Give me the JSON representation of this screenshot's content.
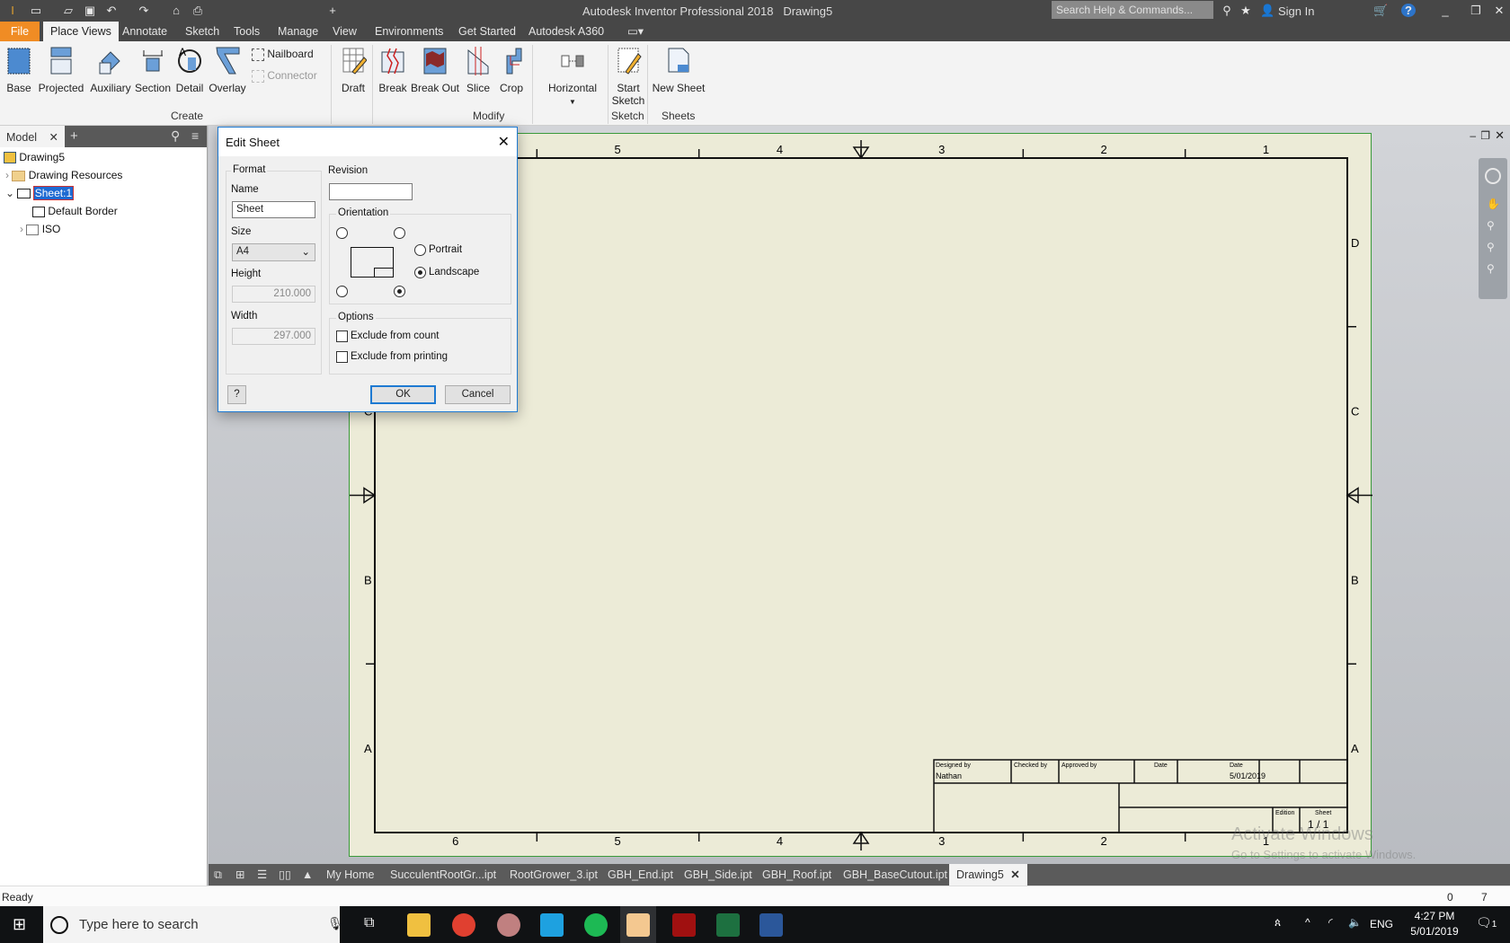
{
  "app": {
    "title": "Autodesk Inventor Professional 2018",
    "document": "Drawing5",
    "search_placeholder": "Search Help & Commands...",
    "sign_in": "Sign In"
  },
  "ribbon_tabs": [
    "File",
    "Place Views",
    "Annotate",
    "Sketch",
    "Tools",
    "Manage",
    "View",
    "Environments",
    "Get Started",
    "Autodesk A360"
  ],
  "active_tab": "Place Views",
  "ribbon": {
    "create": {
      "label": "Create",
      "buttons": [
        "Base",
        "Projected",
        "Auxiliary",
        "Section",
        "Detail",
        "Overlay"
      ],
      "small": [
        "Nailboard",
        "Connector"
      ]
    },
    "modify": {
      "label": "Modify",
      "buttons": [
        "Draft",
        "Break",
        "Break Out",
        "Slice",
        "Crop",
        "Horizontal"
      ]
    },
    "sketch": {
      "label": "Sketch",
      "buttons": [
        "Start\nSketch"
      ]
    },
    "sheets": {
      "label": "Sheets",
      "buttons": [
        "New Sheet"
      ]
    }
  },
  "browser": {
    "tab": "Model",
    "items": [
      "Drawing5",
      "Drawing Resources",
      "Sheet:1",
      "Default Border",
      "ISO"
    ]
  },
  "sheet": {
    "zones_top": [
      "6",
      "5",
      "4",
      "3",
      "2",
      "1"
    ],
    "zones_side": [
      "D",
      "C",
      "B",
      "A"
    ],
    "title_block": {
      "designed_by_label": "Designed by",
      "designed_by": "Nathan",
      "checked_by_label": "Checked by",
      "approved_by_label": "Approved by",
      "date_label": "Date",
      "date_label2": "Date",
      "date": "5/01/2019",
      "edition_label": "Edition",
      "sheet_label": "Sheet",
      "sheet_value": "1 / 1"
    }
  },
  "watermark": {
    "line1": "Activate Windows",
    "line2": "Go to Settings to activate Windows."
  },
  "dialog": {
    "title": "Edit Sheet",
    "format_label": "Format",
    "name_label": "Name",
    "name_value": "Sheet",
    "size_label": "Size",
    "size_value": "A4",
    "height_label": "Height",
    "height_value": "210.000",
    "width_label": "Width",
    "width_value": "297.000",
    "revision_label": "Revision",
    "revision_value": "",
    "orientation_label": "Orientation",
    "portrait": "Portrait",
    "landscape": "Landscape",
    "orientation_selected": "Landscape",
    "corner_selected": "bottom-right",
    "options_label": "Options",
    "exclude_count": "Exclude from count",
    "exclude_printing": "Exclude from printing",
    "exclude_count_checked": false,
    "exclude_printing_checked": false,
    "ok": "OK",
    "cancel": "Cancel"
  },
  "doc_tabs": [
    "My Home",
    "SucculentRootGr...ipt",
    "RootGrower_3.ipt",
    "GBH_End.ipt",
    "GBH_Side.ipt",
    "GBH_Roof.ipt",
    "GBH_BaseCutout.ipt",
    "Drawing5"
  ],
  "status": {
    "text": "Ready",
    "count1": "0",
    "count2": "7"
  },
  "taskbar": {
    "search_placeholder": "Type here to search",
    "lang": "ENG",
    "time": "4:27 PM",
    "date": "5/01/2019",
    "notifications": "1"
  },
  "colors": {
    "file_tab": "#f08c24",
    "sheet": "#ecebd7",
    "selection": "#1e6ad2",
    "dialog_accent": "#1e7ad2"
  }
}
